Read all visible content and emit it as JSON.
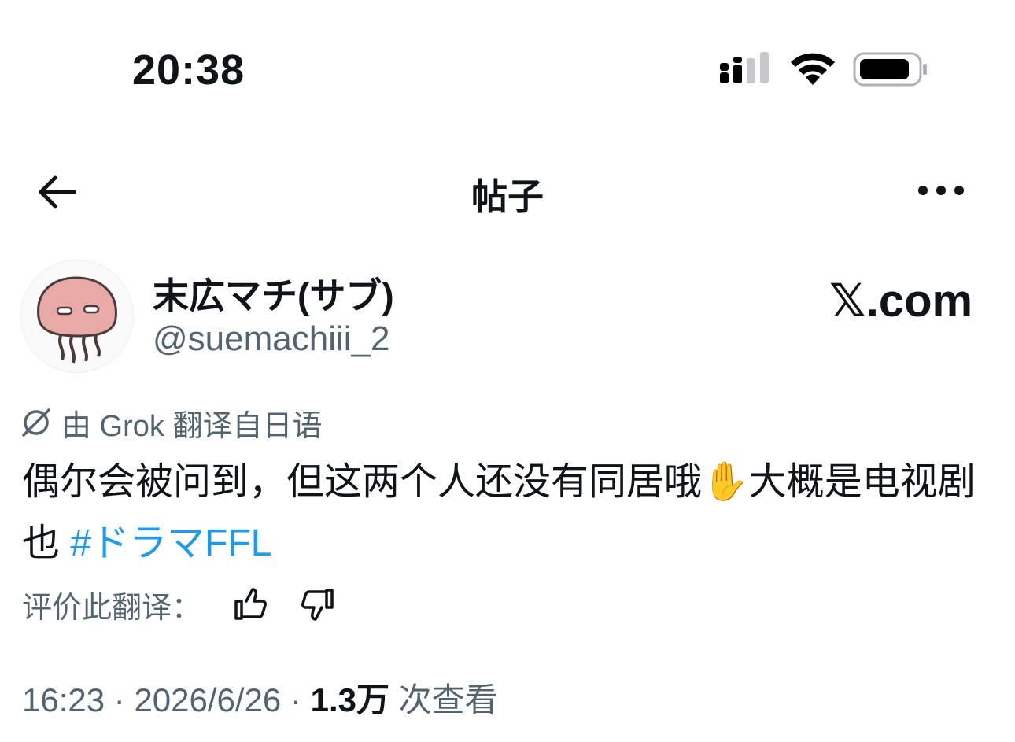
{
  "status_bar": {
    "time": "20:38",
    "icons": [
      "cellular-signal-icon",
      "wifi-icon",
      "battery-icon"
    ]
  },
  "nav": {
    "title": "帖子",
    "back_icon": "arrow-left-icon",
    "more_icon": "more-horizontal-icon"
  },
  "author": {
    "display_name": "末広マチ(サブ)",
    "handle": "@suemachiii_2",
    "avatar": "jellyfish-avatar"
  },
  "brand": {
    "x_glyph": "𝕏",
    "domain": ".com"
  },
  "translation": {
    "note": "由 Grok 翻译自日语",
    "icon": "grok-icon"
  },
  "post": {
    "text": "偶尔会被问到，但这两个人还没有同居哦✋大概是电视剧也 ",
    "hashtag": "#ドラマFFL"
  },
  "rating": {
    "label": "评价此翻译：",
    "up_icon": "thumbs-up-icon",
    "down_icon": "thumbs-down-icon"
  },
  "meta": {
    "time": "16:23",
    "sep1": " · ",
    "date": "2026/6/26",
    "sep2": " · ",
    "views_count": "1.3万",
    "views_label": " 次查看"
  },
  "colors": {
    "text": "#0f1419",
    "secondary": "#536471",
    "link": "#1d9bf0"
  }
}
